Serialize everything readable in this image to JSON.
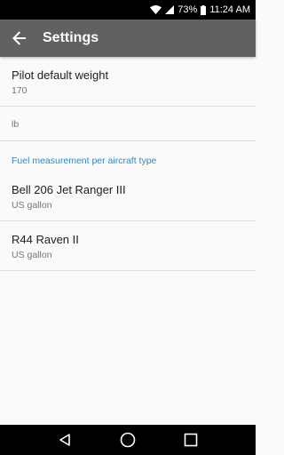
{
  "status_bar": {
    "battery_percent": "73%",
    "time": "11:24 AM"
  },
  "app_bar": {
    "title": "Settings"
  },
  "preferences": {
    "pilot_weight": {
      "title": "Pilot default weight",
      "value": "170"
    },
    "weight_unit": {
      "value": "lb"
    },
    "category": "Fuel measurement per aircraft type",
    "bell206": {
      "title": "Bell 206 Jet Ranger III",
      "value": "US gallon"
    },
    "r44": {
      "title": "R44 Raven II",
      "value": "US gallon"
    }
  }
}
